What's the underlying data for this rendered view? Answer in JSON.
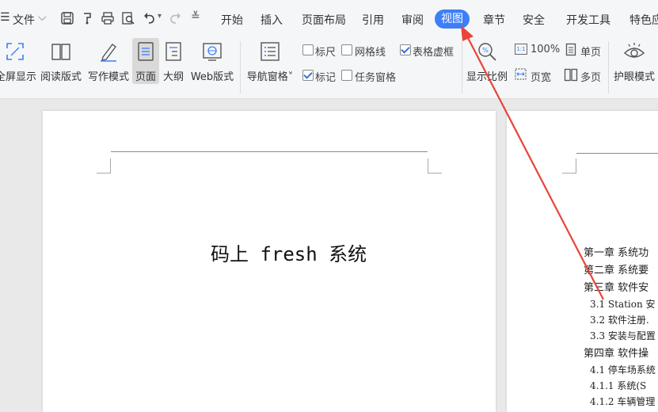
{
  "menu": {
    "file_label": "文件"
  },
  "tabs": [
    {
      "label": "开始"
    },
    {
      "label": "插入"
    },
    {
      "label": "页面布局"
    },
    {
      "label": "引用"
    },
    {
      "label": "审阅"
    },
    {
      "label": "视图"
    },
    {
      "label": "章节"
    },
    {
      "label": "安全"
    },
    {
      "label": "开发工具"
    },
    {
      "label": "特色应"
    }
  ],
  "active_tab": "视图",
  "accent_color": "#3d7ff8",
  "annotation_color": "#e8443a",
  "toolbar": {
    "fullscreen": "全屏显示",
    "read_mode": "阅读版式",
    "write_mode": "写作模式",
    "page_view": "页面",
    "outline": "大纲",
    "web_layout": "Web版式",
    "nav_pane": "导航窗格",
    "ruler": "标尺",
    "gridlines": "网格线",
    "table_gridlines": "表格虚框",
    "markup": "标记",
    "task_pane": "任务窗格",
    "zoom": "显示比例",
    "zoom_100": "100%",
    "page_width": "页宽",
    "single_page": "单页",
    "multi_page": "多页",
    "eye_protect": "护眼模式"
  },
  "checkboxes": {
    "ruler": false,
    "gridlines": false,
    "table_gridlines": true,
    "markup": true,
    "task_pane": false
  },
  "document": {
    "title": "码上 fresh 系统",
    "toc": [
      "第一章  系统功",
      "第二章  系统要",
      "第三章  软件安",
      "3.1 Station 安",
      "3.2 软件注册.",
      "3.3 安装与配置",
      "第四章  软件操",
      "4.1 停车场系统",
      "4.1.1  系统(S",
      "4.1.2 车辆管理"
    ]
  }
}
